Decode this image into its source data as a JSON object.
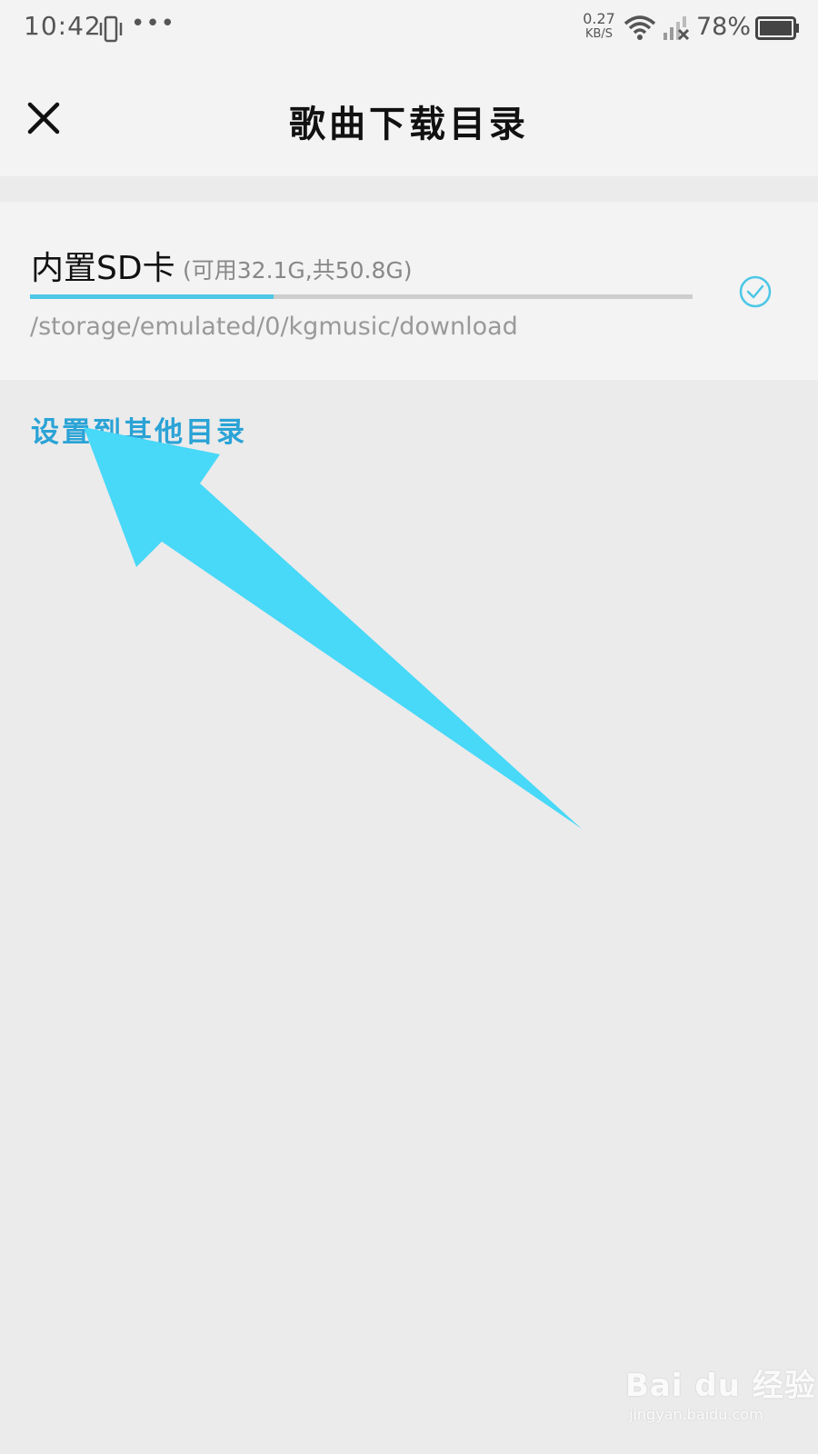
{
  "status_bar": {
    "time": "10:42",
    "more": "•••",
    "net_speed_value": "0.27",
    "net_speed_unit": "KB/S",
    "battery_percent": "78%"
  },
  "header": {
    "title": "歌曲下载目录",
    "close_icon": "close-icon"
  },
  "directory": {
    "name": "内置SD卡",
    "capacity_info": "(可用32.1G,共50.8G)",
    "used_fraction": 0.368,
    "path": "/storage/emulated/0/kgmusic/download",
    "selected": true
  },
  "other_directory_link": "设置到其他目录",
  "colors": {
    "accent": "#4cc7e6",
    "link": "#2aa3d6",
    "arrow": "#48d8f8"
  },
  "watermark": {
    "logo": "Bai du 经验",
    "url": "jingyan.baidu.com"
  }
}
